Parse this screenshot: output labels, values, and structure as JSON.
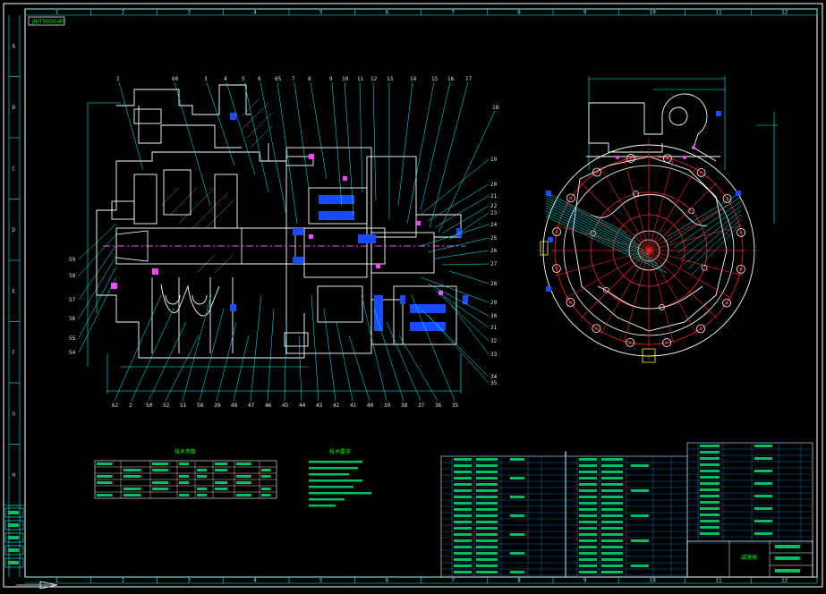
{
  "drawing": {
    "corner_stamp": "JB/T5000-85",
    "top_ruler": [
      "1",
      "2",
      "3",
      "4",
      "5",
      "6",
      "7",
      "8",
      "9",
      "10",
      "11",
      "12"
    ],
    "bottom_ruler": [
      "1",
      "2",
      "3",
      "4",
      "5",
      "6",
      "7",
      "8",
      "9",
      "10",
      "11",
      "12"
    ],
    "left_ruler": [
      "A",
      "B",
      "C",
      "D",
      "E",
      "F",
      "G",
      "H"
    ],
    "balloons_top": [
      "1",
      "60",
      "3",
      "4",
      "5",
      "6",
      "65",
      "7",
      "8",
      "9",
      "10",
      "11",
      "12",
      "13",
      "14",
      "15",
      "16",
      "17",
      "18"
    ],
    "balloons_right": [
      "19",
      "20",
      "21",
      "22",
      "23",
      "24",
      "25",
      "26",
      "27",
      "28",
      "29",
      "30",
      "31",
      "32",
      "33",
      "34",
      "35"
    ],
    "balloons_bottom": [
      "62",
      "2",
      "50",
      "52",
      "51",
      "58",
      "39",
      "48",
      "47",
      "46",
      "45",
      "44",
      "43",
      "42",
      "41",
      "40",
      "39",
      "38",
      "37",
      "36",
      "35"
    ],
    "balloons_left": [
      "59",
      "58",
      "57",
      "56",
      "55",
      "54"
    ],
    "spec_table_title": "技术参数",
    "tech_req_title": "技术要求",
    "title_block_name": "减速器",
    "colors": {
      "background": "#000000",
      "frame": "#ffffff",
      "outline": "#ffffff",
      "centerline": "#ff2020",
      "leader": "#00ffff",
      "dimension": "#00ffff",
      "blue_hatch": "#1a4cff",
      "magenta": "#ff40ff",
      "yellow": "#ffff00",
      "green_text": "#00ff00"
    }
  }
}
